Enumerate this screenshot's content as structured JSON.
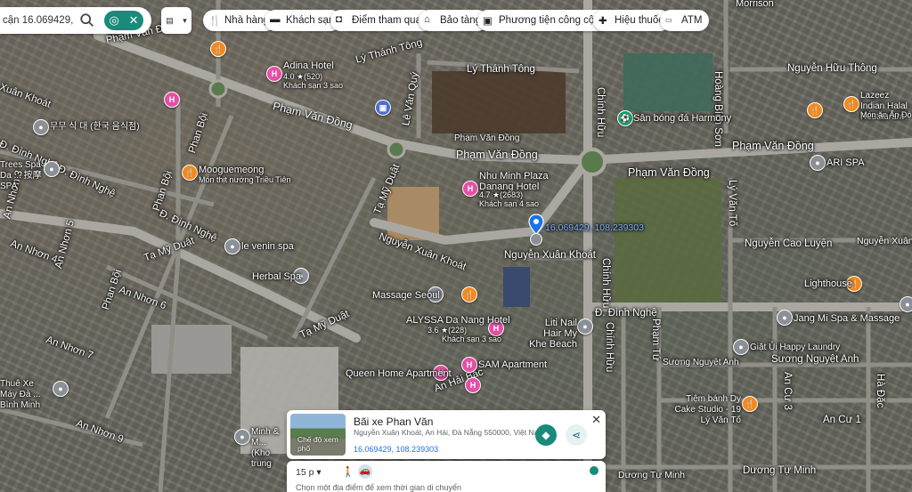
{
  "search": {
    "value": "cận 16.069429, 108"
  },
  "chips": [
    {
      "label": "Nhà hàng",
      "icon": "fork-knife-icon"
    },
    {
      "label": "Khách sạn",
      "icon": "bed-icon"
    },
    {
      "label": "Điểm tham quan",
      "icon": "camera-icon"
    },
    {
      "label": "Bảo tàng",
      "icon": "museum-icon"
    },
    {
      "label": "Phương tiện công cộng",
      "icon": "bus-icon"
    },
    {
      "label": "Hiệu thuốc",
      "icon": "pharmacy-icon"
    },
    {
      "label": "ATM",
      "icon": "atm-icon"
    }
  ],
  "roads": {
    "morrison": "Morrison",
    "pham_van_dong_w": "Phạm Văn Đồng",
    "pham_van_dong_nw": "Phạm Văn Đồng",
    "pham_van_dong_c1": "Phạm Văn Đồng",
    "pham_van_dong_c2": "Phạm Văn Đồng",
    "pham_van_dong_e": "Phạm Văn Đồng",
    "pham_van_dong_ne": "Phạm Văn Đồng",
    "ly_thanh_tong1": "Lý Thánh Tông",
    "ly_thanh_tong2": "Lý Thánh Tông",
    "nguyen_huu_thong": "Nguyễn Hữu Thông",
    "hoang_bich_son": "Hoàng Bích Sơn",
    "chinh_huu1": "Chính Hữu",
    "chinh_huu2": "Chính Hữu",
    "chinh_huu3": "Chính Hữu",
    "le_van_quy": "Lê Văn Quý",
    "xuan_khoat_nw": "Xuân Khoát",
    "dinh_nghe1": "Đ. Đình Nghệ",
    "dinh_nghe2": "Đ. Đình Nghệ",
    "dinh_nghe3": "Đ. Đình Nghệ",
    "dinh_nghe4": "Đ. Đình Nghệ",
    "phan_boi": "Phan Bội",
    "phan_boi2": "Phan Bội",
    "phan_boi3": "Phan Bội",
    "ta_my_duat1": "Tạ Mỹ Duật",
    "ta_my_duat2": "Tạ Mỹ Duật",
    "ta_my_duat3": "Tạ Mỹ Duật",
    "nguyen_xuan_khoat1": "Nguyễn Xuân Khoát",
    "nguyen_xuan_khoat2": "Nguyễn Xuân Khoát",
    "an_nhon3": "An Nhơn 3",
    "an_nhon4": "An Nhơn 4",
    "an_nhon5": "An Nhơn 5",
    "an_nhon6": "An Nhơn 6",
    "an_nhon7": "An Nhơn 7",
    "an_nhon9": "An Nhơn 9",
    "an_hai_bac": "An Hải Bắc",
    "ly_van_to1": "Lý Văn Tố",
    "ly_van_to2": "Lý Văn Tố",
    "nguyen_cao_luyen": "Nguyễn Cao Luyện",
    "nguyen_xuan_khoat_e": "Nguyễn Xuân Khoát",
    "suong_nguyet_anh1": "Sương Nguyệt Anh",
    "suong_nguyet_anh2": "Sương Nguyệt Anh",
    "an_cu3": "An Cư 3",
    "an_cu1": "An Cư 1",
    "ha_dac": "Hà Đặc",
    "duong_tu_minh1": "Dương Tự Minh",
    "duong_tu_minh2": "Dương Tự Minh",
    "pham_tu": "Phạm Tứ"
  },
  "places": [
    {
      "name": "Adina Hotel",
      "sub": "Khách sạn 3 sao",
      "rating": "4.0 ★(520)"
    },
    {
      "name": "Nhu Minh Plaza Danang Hotel",
      "sub": "Khách sạn 4 sao",
      "rating": "4.7 ★(2683)"
    },
    {
      "name": "ALYSSA Da Nang Hotel",
      "sub": "Khách sạn 3 sao",
      "rating": "3.6 ★(228)"
    },
    {
      "name": "Mooguemeong",
      "sub": "Món thịt nướng Triều Tiên"
    },
    {
      "name": "Herbal Spa"
    },
    {
      "name": "le venin spa"
    },
    {
      "name": "Massage Seoul"
    },
    {
      "name": "Liti Nail Hair My Khe Beach"
    },
    {
      "name": "SAM Apartment"
    },
    {
      "name": "Queen Home Apartment"
    },
    {
      "name": "Sân bóng đá Harmony"
    },
    {
      "name": "ARI SPA"
    },
    {
      "name": "Lazeez Indian Halal Restaurant",
      "sub": "Món ăn Ấn Độ"
    },
    {
      "name": "Lighthouse"
    },
    {
      "name": "Jang Mi Spa & Massage"
    },
    {
      "name": "Giặt Ủi Happy Laundry"
    },
    {
      "name": "Tiệm bánh Dy Cake Studio - 19 Lý Văn Tố"
    },
    {
      "name": "Minh & M... (Kho trung"
    },
    {
      "name": "Thuê Xe Máy Đà ... Bình Minh"
    },
    {
      "name": "Trees Spa Da ... 按摩SPA"
    },
    {
      "name": "무무 식 대 (한국 음식점)"
    }
  ],
  "pin_coords": "16.069429, 108.239303",
  "card": {
    "title": "Bãi xe Phan Văn",
    "address": "Nguyễn Xuân Khoát, An Hải, Đà Nẵng 550000, Việt Nam",
    "coords": "16.069429, 108.239303",
    "street_view": "Chế độ xem phố",
    "time": "15 p",
    "hint": "Chọn một địa điểm để xem thời gian di chuyển"
  },
  "colors": {
    "accent": "#1a8a7c",
    "pin_blue": "#1a73e8",
    "hotel": "#e54fa6",
    "food": "#f28a1e"
  }
}
